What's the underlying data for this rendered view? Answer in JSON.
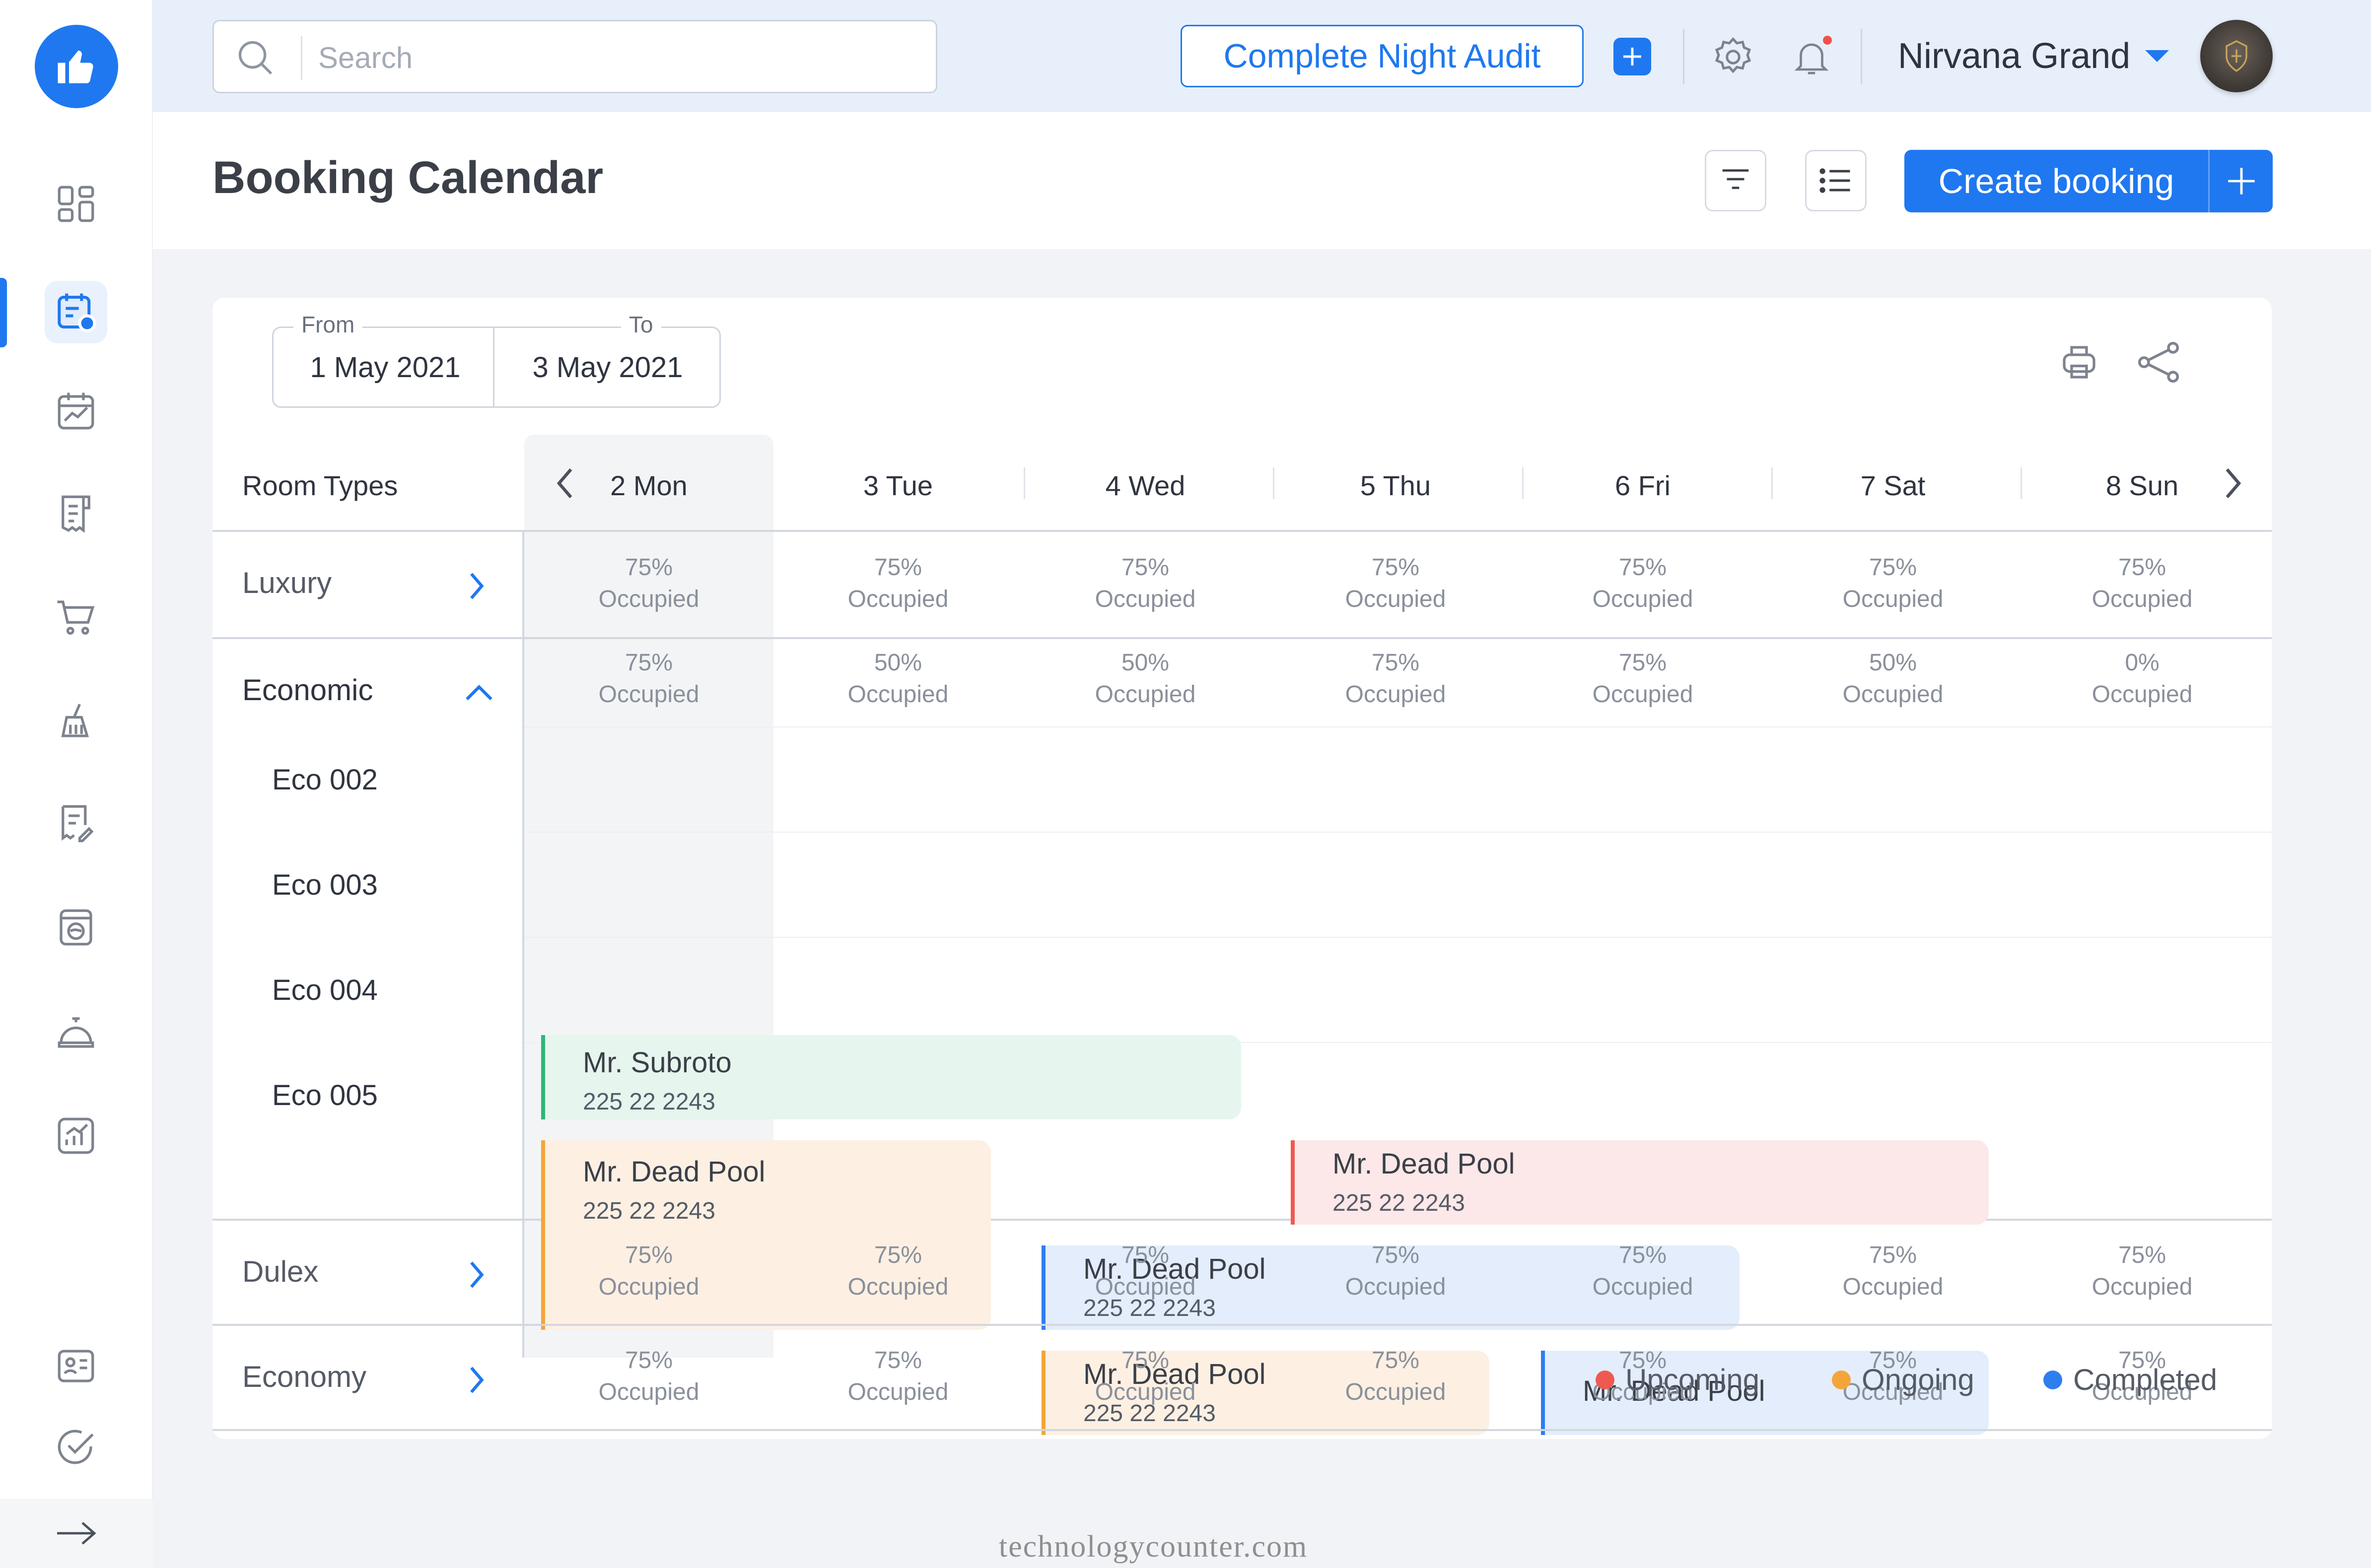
{
  "header": {
    "search_placeholder": "Search",
    "audit_button": "Complete Night Audit",
    "hotel_name": "Nirvana Grand"
  },
  "page": {
    "title": "Booking Calendar",
    "create_button": "Create booking"
  },
  "date_range": {
    "from_label": "From",
    "from_value": "1 May 2021",
    "to_label": "To",
    "to_value": "3 May 2021"
  },
  "calendar": {
    "room_types_label": "Room Types",
    "days": [
      "2 Mon",
      "3 Tue",
      "4 Wed",
      "5 Thu",
      "6 Fri",
      "7 Sat",
      "8 Sun"
    ],
    "occupied_label": "Occupied",
    "rows": [
      {
        "name": "Luxury",
        "expanded": false,
        "occupancy": [
          "75%",
          "75%",
          "75%",
          "75%",
          "75%",
          "75%",
          "75%"
        ]
      },
      {
        "name": "Economic",
        "expanded": true,
        "occupancy": [
          "75%",
          "50%",
          "50%",
          "75%",
          "75%",
          "50%",
          "0%"
        ],
        "rooms": [
          "Eco 002",
          "Eco 003",
          "Eco 004",
          "Eco 005"
        ]
      },
      {
        "name": "Dulex",
        "expanded": false,
        "occupancy": [
          "75%",
          "75%",
          "75%",
          "75%",
          "75%",
          "75%",
          "75%"
        ]
      },
      {
        "name": "Economy",
        "expanded": false,
        "occupancy": [
          "75%",
          "75%",
          "75%",
          "75%",
          "75%",
          "75%",
          "75%"
        ]
      }
    ]
  },
  "bookings": [
    {
      "guest": "Mr. Subroto",
      "phone": "225 22 2243",
      "status_color": "#2fb574",
      "bg": "#e6f5ee"
    },
    {
      "guest": "Mr. Dead Pool",
      "phone": "225 22 2243",
      "status_color": "#f4a53a",
      "bg": "#fdf0e3"
    },
    {
      "guest": "Mr. Dead Pool",
      "phone": "225 22 2243",
      "status_color": "#ee5a52",
      "bg": "#fce8e8"
    },
    {
      "guest": "Mr. Dead Pool",
      "phone": "225 22 2243",
      "status_color": "#2d7ff0",
      "bg": "#e3edfc"
    },
    {
      "guest": "Mr. Dead Pool",
      "phone": "225 22 2243",
      "status_color": "#f4a53a",
      "bg": "#fdf0e3"
    },
    {
      "guest": "Mr. Dead Pool",
      "status_color": "#2d7ff0",
      "bg": "#e3edfc"
    }
  ],
  "legend": [
    {
      "label": "Upcoming",
      "color": "#ee5a52"
    },
    {
      "label": "Ongoing",
      "color": "#f4a53a"
    },
    {
      "label": "Completed",
      "color": "#2d7ff0"
    }
  ],
  "watermark": "technologycounter.com",
  "colors": {
    "accent": "#1f78f0"
  }
}
